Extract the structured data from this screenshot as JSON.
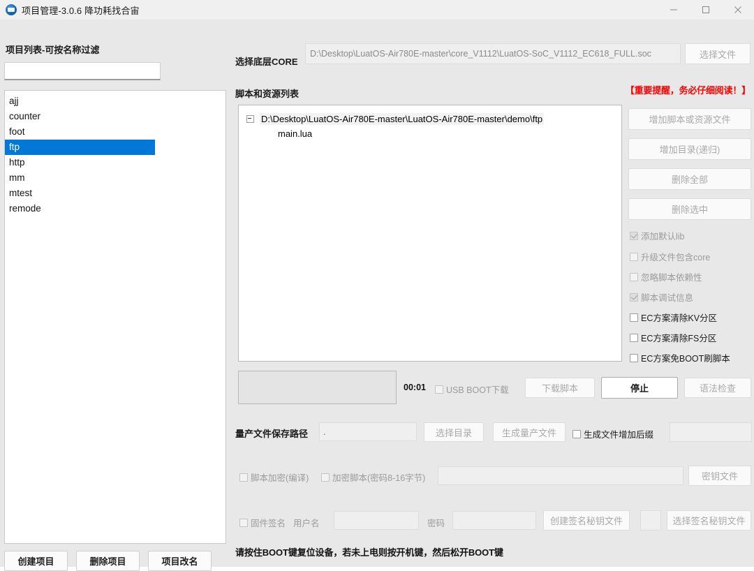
{
  "window": {
    "title": "项目管理-3.0.6 降功耗找合宙",
    "icon": "app-logo-icon",
    "controls": {
      "minimize": "minimize-icon",
      "maximize": "maximize-icon",
      "close": "close-icon"
    }
  },
  "left_panel": {
    "header": "项目列表-可按名称过滤",
    "filter": {
      "value": "",
      "placeholder": ""
    },
    "projects": [
      {
        "name": "ajj",
        "selected": false
      },
      {
        "name": "counter",
        "selected": false
      },
      {
        "name": "foot",
        "selected": false
      },
      {
        "name": "ftp",
        "selected": true
      },
      {
        "name": "http",
        "selected": false
      },
      {
        "name": "mm",
        "selected": false
      },
      {
        "name": "mtest",
        "selected": false
      },
      {
        "name": "remode",
        "selected": false
      }
    ],
    "buttons": [
      {
        "label": "创建项目",
        "name": "create-project-button"
      },
      {
        "label": "删除项目",
        "name": "delete-project-button"
      },
      {
        "label": "项目改名",
        "name": "rename-project-button"
      }
    ]
  },
  "core": {
    "label": "选择底层CORE",
    "path": "D:\\Desktop\\LuatOS-Air780E-master\\core_V1112\\LuatOS-SoC_V1112_EC618_FULL.soc",
    "choose_file_button": "选择文件"
  },
  "scripts": {
    "label": "脚本和资源列表",
    "warning": "【重要提醒，务必仔细阅读！】",
    "warning_color": "#ff0000",
    "tree": {
      "root": "D:\\Desktop\\LuatOS-Air780E-master\\LuatOS-Air780E-master\\demo\\ftp",
      "children": [
        "main.lua"
      ]
    },
    "side_buttons": [
      {
        "label": "增加脚本或资源文件",
        "name": "add-script-or-resource-button",
        "disabled": true
      },
      {
        "label": "增加目录(递归)",
        "name": "add-directory-recursive-button",
        "disabled": true
      },
      {
        "label": "删除全部",
        "name": "delete-all-button",
        "disabled": true
      },
      {
        "label": "删除选中",
        "name": "delete-selected-button",
        "disabled": true
      }
    ],
    "checkboxes": [
      {
        "label": "添加默认lib",
        "checked": true,
        "disabled": true,
        "name": "add-default-lib-checkbox"
      },
      {
        "label": "升级文件包含core",
        "checked": false,
        "disabled": true,
        "name": "upgrade-file-include-core-checkbox"
      },
      {
        "label": "忽略脚本依赖性",
        "checked": false,
        "disabled": true,
        "name": "ignore-script-dependency-checkbox"
      },
      {
        "label": "脚本调试信息",
        "checked": true,
        "disabled": true,
        "name": "script-debug-info-checkbox"
      },
      {
        "label": "EC方案清除KV分区",
        "checked": false,
        "disabled": false,
        "name": "ec-clear-kv-partition-checkbox"
      },
      {
        "label": "EC方案清除FS分区",
        "checked": false,
        "disabled": false,
        "name": "ec-clear-fs-partition-checkbox"
      },
      {
        "label": "EC方案免BOOT刷脚本",
        "checked": false,
        "disabled": false,
        "name": "ec-no-boot-flash-script-checkbox"
      }
    ]
  },
  "download": {
    "timer": "00:01",
    "usb_boot": {
      "label": "USB BOOT下载",
      "checked": false
    },
    "download_script_button": {
      "label": "下载脚本",
      "disabled": true
    },
    "stop_button": {
      "label": "停止",
      "disabled": false
    },
    "syntax_check_button": {
      "label": "语法检查",
      "disabled": true
    }
  },
  "mass_production": {
    "label": "量产文件保存路径",
    "path": ".",
    "choose_dir_button": "选择目录",
    "generate_button": "生成量产文件",
    "suffix_checkbox": {
      "label": "生成文件增加后缀",
      "checked": false
    },
    "suffix_value": ""
  },
  "encryption": {
    "compile_checkbox": {
      "label": "脚本加密(编译)",
      "checked": false
    },
    "encrypt_checkbox": {
      "label": "加密脚本(密码8-16字节)",
      "checked": false
    },
    "key_value": "",
    "key_file_button": "密钥文件"
  },
  "signature": {
    "firmware_sign_checkbox": {
      "label": "固件签名",
      "checked": false
    },
    "username_label": "用户名",
    "username_value": "",
    "password_label": "密码",
    "password_value": "",
    "create_key_button": "创建签名秘钥文件",
    "select_key_button": "选择签名秘钥文件"
  },
  "status": {
    "message": "请按住BOOT键复位设备，若未上电则按开机键，然后松开BOOT键"
  }
}
